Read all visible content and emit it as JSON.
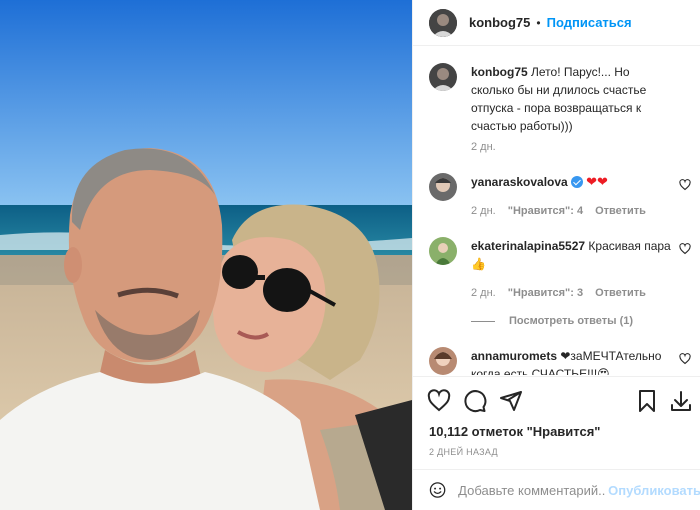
{
  "post": {
    "username": "konbog75",
    "separator": "•",
    "follow_label": "Подписаться",
    "caption": "Лето! Парус!... Но сколько бы ни длилось счастье отпуска - пора возвращаться к счастью работы)))",
    "caption_time": "2 дн."
  },
  "comments": [
    {
      "username": "yanaraskovalova",
      "verified": true,
      "text": "❤❤",
      "time": "2 дн.",
      "likes": "\"Нравится\": 4",
      "reply": "Ответить"
    },
    {
      "username": "ekaterinalapina5527",
      "verified": false,
      "text": "Красивая пара 👍",
      "time": "2 дн.",
      "likes": "\"Нравится\": 3",
      "reply": "Ответить",
      "view_replies": "Посмотреть ответы (1)"
    },
    {
      "username": "annamuromets",
      "verified": false,
      "text": "❤заМЕЧТАтельно когда есть СЧАСТЬЕ!!!😍",
      "time": "",
      "likes": "",
      "reply": ""
    }
  ],
  "stats": {
    "likes": "10,112 отметок \"Нравится\"",
    "date": "2 ДНЕЙ НАЗАД"
  },
  "comment_box": {
    "placeholder": "Добавьте комментарий...",
    "publish_label": "Опубликовать"
  },
  "colors": {
    "accent": "#0095f6",
    "publish_disabled": "#b3dbff",
    "like_red": "#ed1c24",
    "text": "#262626",
    "muted": "#8e8e8e"
  },
  "icons": {
    "like": "heart-icon",
    "comment": "comment-icon",
    "share": "share-icon",
    "save": "bookmark-icon",
    "download": "download-icon",
    "emoji": "emoji-icon"
  }
}
